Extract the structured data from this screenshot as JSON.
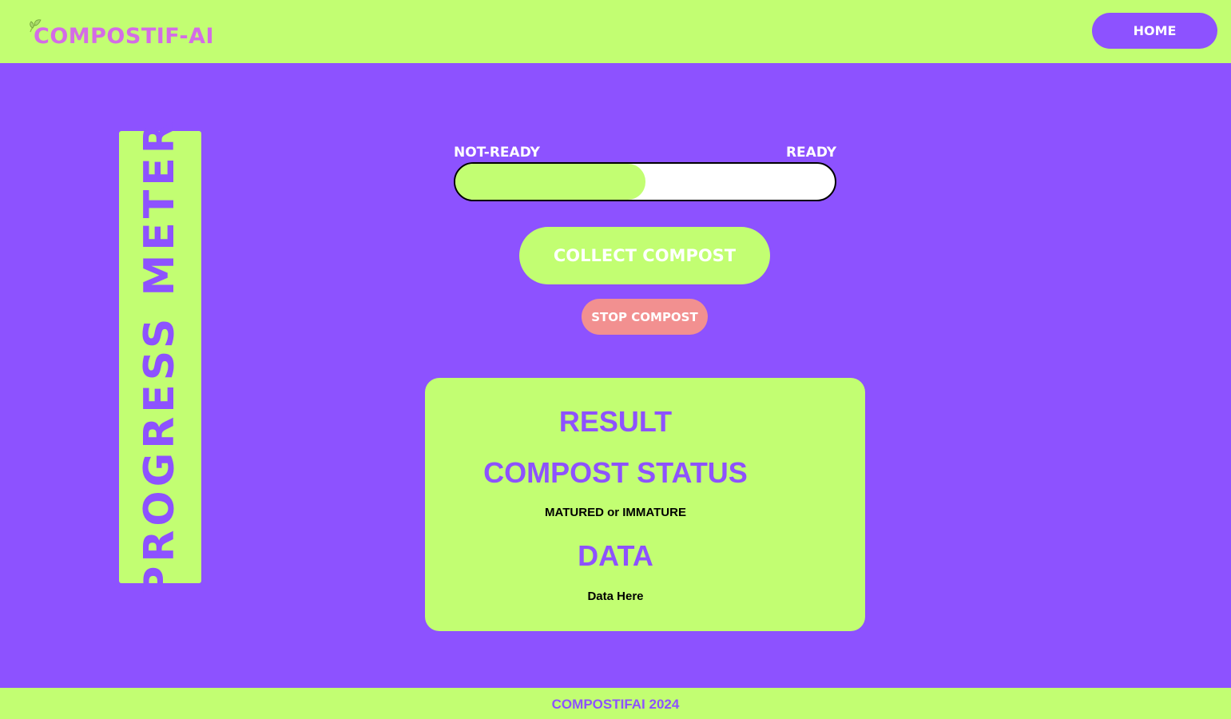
{
  "header": {
    "logo_text": "COMPOSTIF-AI",
    "logo_icon": "leaf-icon",
    "home_label": "HOME"
  },
  "side_panel": {
    "title": "PROGRESS METER"
  },
  "progress": {
    "left_label": "NOT-READY",
    "right_label": "READY",
    "fill_fraction": 0.5
  },
  "actions": {
    "collect_label": "COLLECT COMPOST",
    "stop_label": "STOP COMPOST"
  },
  "result": {
    "heading": "RESULT",
    "status_title": "COMPOST STATUS",
    "status_value": "MATURED or IMMATURE",
    "data_title": "DATA",
    "data_value": "Data Here"
  },
  "footer": {
    "text": "COMPOSTIFAI 2024"
  },
  "colors": {
    "purple": "#8d52ff",
    "lime": "#c2fe72",
    "logo_pink": "#d46ce6",
    "stop_red": "#f29090",
    "white": "#ffffff"
  }
}
